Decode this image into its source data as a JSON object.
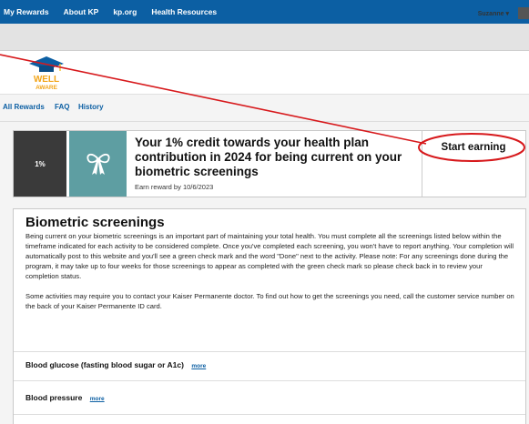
{
  "top_nav": [
    "My Rewards",
    "About KP",
    "kp.org",
    "Health Resources"
  ],
  "user": {
    "name": "Suzanne",
    "caret": "▾"
  },
  "logo": {
    "line1": "WELL",
    "line2": "AWARE"
  },
  "tabs": [
    "All Rewards",
    "FAQ",
    "History"
  ],
  "reward": {
    "percent": "1%",
    "title": "Your 1% credit towards your health plan contribution in 2024 for being current on your biometric screenings",
    "subtitle": "Earn reward by 10/6/2023",
    "action_label": "Start earning"
  },
  "section": {
    "title": "Biometric screenings",
    "paragraph1": "Being current on your biometric screenings is an important part of maintaining your total health. You must complete all the screenings listed below within the timeframe indicated for each activity to be considered complete. Once you've completed each screening, you won't have to report anything. Your completion will automatically post to this website and you'll see a green check mark and the word \"Done\" next to the activity. Please note: For any screenings done during the program, it may take up to four weeks for those screenings to appear as completed with the green check mark so please check back in to review your completion status.",
    "paragraph2": "Some activities may require you to contact your Kaiser Permanente doctor. To find out how to get the screenings you need, call the customer service number on the back of your Kaiser Permanente ID card."
  },
  "activities": [
    {
      "label": "Blood glucose (fasting blood sugar or A1c)",
      "more": "more"
    },
    {
      "label": "Blood pressure",
      "more": "more"
    }
  ],
  "colors": {
    "nav": "#0c5fa3",
    "annotation": "#d7191c",
    "gift": "#5e9ea2"
  }
}
